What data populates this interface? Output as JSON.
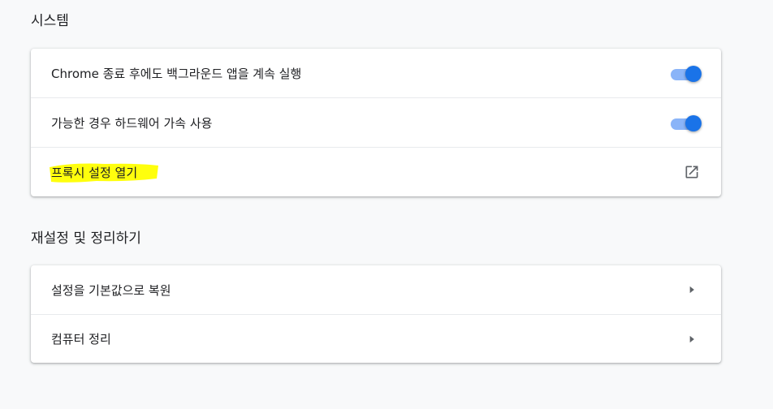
{
  "sections": {
    "system": {
      "title": "시스템",
      "rows": [
        {
          "label": "Chrome 종료 후에도 백그라운드 앱을 계속 실행",
          "toggle_on": true
        },
        {
          "label": "가능한 경우 하드웨어 가속 사용",
          "toggle_on": true
        },
        {
          "label": "프록시 설정 열기",
          "icon": "open-in-new-icon",
          "highlighted": true
        }
      ]
    },
    "reset": {
      "title": "재설정 및 정리하기",
      "rows": [
        {
          "label": "설정을 기본값으로 복원",
          "icon": "arrow-right-icon"
        },
        {
          "label": "컴퓨터 정리",
          "icon": "arrow-right-icon"
        }
      ]
    }
  },
  "colors": {
    "toggle_knob": "#1a73e8",
    "toggle_track": "#8ab4f8",
    "highlight": "#ffff00",
    "background": "#f8f9fa"
  }
}
